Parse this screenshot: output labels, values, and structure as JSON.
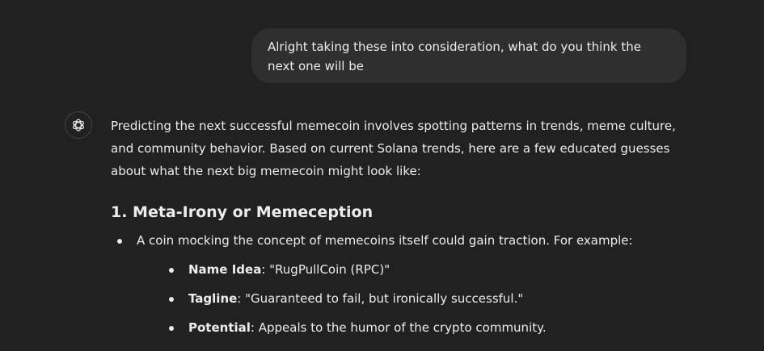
{
  "user_message": {
    "text": "Alright taking these into consideration, what do you think the next one will be"
  },
  "assistant_icon": "openai-logo-icon",
  "assistant": {
    "intro": "Predicting the next successful memecoin involves spotting patterns in trends, meme culture, and community behavior. Based on current Solana trends, here are a few educated guesses about what the next big memecoin might look like:",
    "section_heading": "1. Meta-Irony or Memeception",
    "bullet": "A coin mocking the concept of memecoins itself could gain traction. For example:",
    "sub_items": [
      {
        "label": "Name Idea",
        "text": ": \"RugPullCoin (RPC)\""
      },
      {
        "label": "Tagline",
        "text": ": \"Guaranteed to fail, but ironically successful.\""
      },
      {
        "label": "Potential",
        "text": ": Appeals to the humor of the crypto community."
      }
    ]
  },
  "colors": {
    "background": "#212121",
    "bubble": "#2f2f2f",
    "text": "#ececec"
  }
}
